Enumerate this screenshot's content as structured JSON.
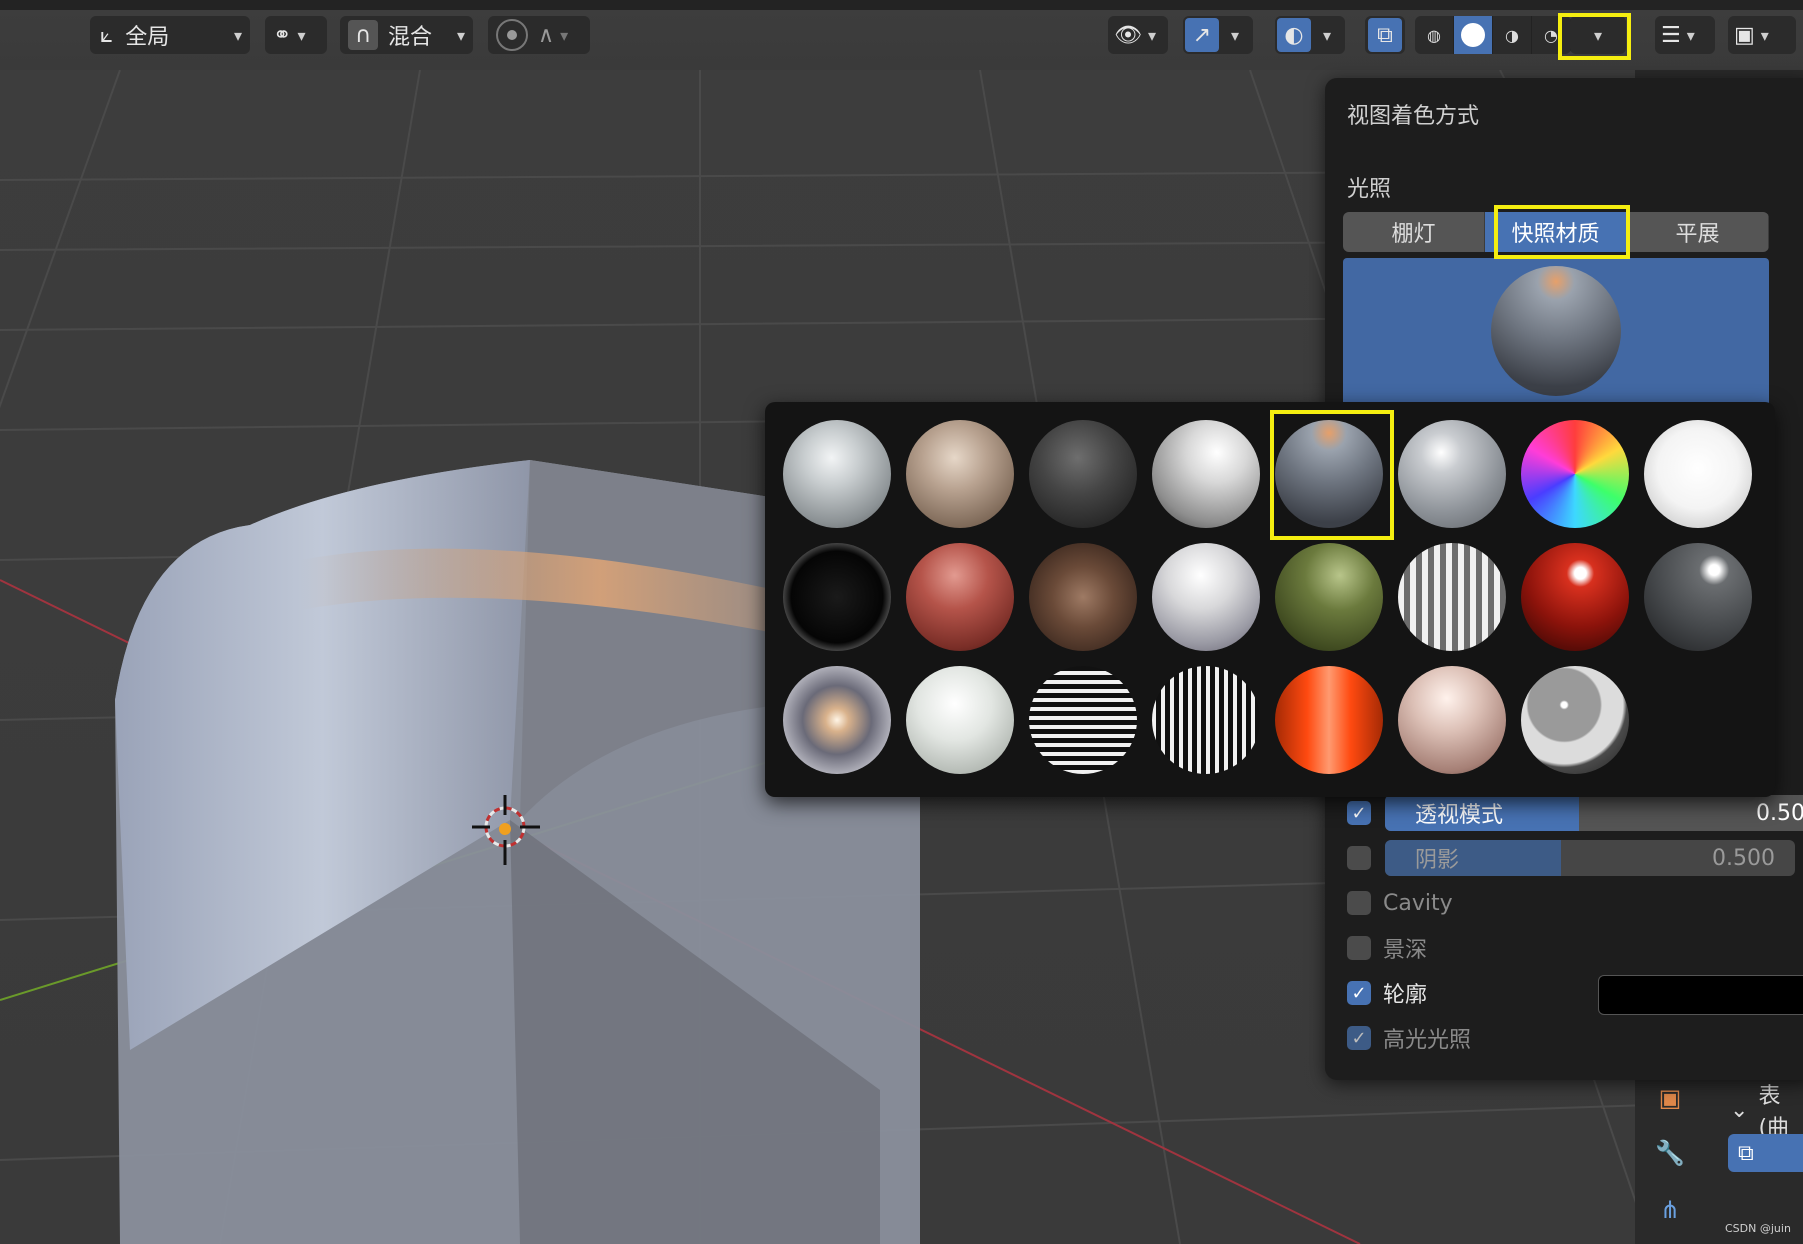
{
  "toolbar": {
    "orientation_label": "全局",
    "snap_mode_label": "混合"
  },
  "shading_popover": {
    "title": "视图着色方式",
    "lighting_section": "光照",
    "lighting_tabs": [
      {
        "label": "棚灯",
        "active": false
      },
      {
        "label": "快照材质",
        "active": true
      },
      {
        "label": "平展",
        "active": false
      }
    ],
    "options": {
      "xray": {
        "label": "透视模式",
        "value": "0.500",
        "checked": true
      },
      "shadow": {
        "label": "阴影",
        "value": "0.500",
        "checked": false
      },
      "cavity": {
        "label": "Cavity",
        "checked": false
      },
      "dof": {
        "label": "景深",
        "checked": false
      },
      "outline": {
        "label": "轮廓",
        "checked": true
      },
      "specular": {
        "label": "高光光照",
        "checked": true
      }
    }
  },
  "matcaps": [
    {
      "name": "matcap-1",
      "selected": false
    },
    {
      "name": "matcap-2",
      "selected": false
    },
    {
      "name": "matcap-3",
      "selected": false
    },
    {
      "name": "matcap-4",
      "selected": false
    },
    {
      "name": "matcap-5",
      "selected": true
    },
    {
      "name": "matcap-6",
      "selected": false
    },
    {
      "name": "matcap-7",
      "selected": false
    },
    {
      "name": "matcap-8",
      "selected": false
    }
  ],
  "properties_panel": {
    "modifier_label": "表(曲"
  },
  "credit": "CSDN @juin"
}
